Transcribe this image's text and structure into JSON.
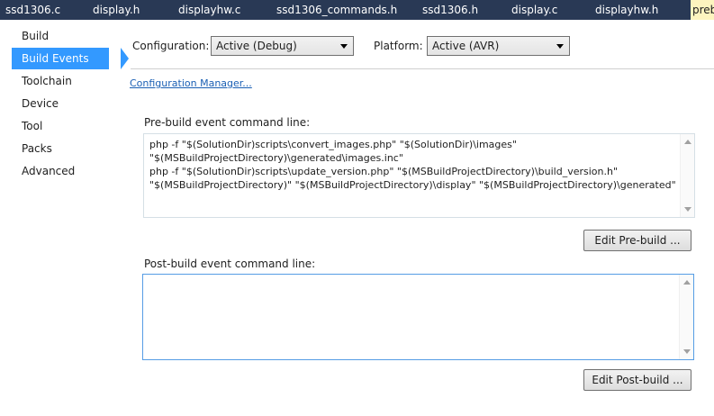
{
  "tabs": [
    {
      "label": "ssd1306.c"
    },
    {
      "label": "display.h"
    },
    {
      "label": "displayhw.c"
    },
    {
      "label": "ssd1306_commands.h"
    },
    {
      "label": "ssd1306.h"
    },
    {
      "label": "display.c"
    },
    {
      "label": "displayhw.h"
    },
    {
      "label": "preb",
      "active": true
    }
  ],
  "sidebar": {
    "items": [
      {
        "label": "Build"
      },
      {
        "label": "Build Events",
        "selected": true
      },
      {
        "label": "Toolchain"
      },
      {
        "label": "Device"
      },
      {
        "label": "Tool"
      },
      {
        "label": "Packs"
      },
      {
        "label": "Advanced"
      }
    ]
  },
  "config": {
    "configuration_label": "Configuration:",
    "configuration_value": "Active (Debug)",
    "platform_label": "Platform:",
    "platform_value": "Active (AVR)",
    "manager_link": "Configuration Manager..."
  },
  "prebuild": {
    "label": "Pre-build event command line:",
    "command": "php -f \"$(SolutionDir)scripts\\convert_images.php\" \"$(SolutionDir)\\images\"\n\"$(MSBuildProjectDirectory)\\generated\\images.inc\"\nphp -f \"$(SolutionDir)scripts\\update_version.php\" \"$(MSBuildProjectDirectory)\\build_version.h\"\n\"$(MSBuildProjectDirectory)\" \"$(MSBuildProjectDirectory)\\display\" \"$(MSBuildProjectDirectory)\\generated\"",
    "edit_button": "Edit Pre-build ..."
  },
  "postbuild": {
    "label": "Post-build event command line:",
    "command": "",
    "edit_button": "Edit Post-build ..."
  },
  "colors": {
    "tab_strip": "#293955",
    "active_tab": "#fdf4bf",
    "selection": "#3399ff",
    "link": "#1a5fb4"
  }
}
